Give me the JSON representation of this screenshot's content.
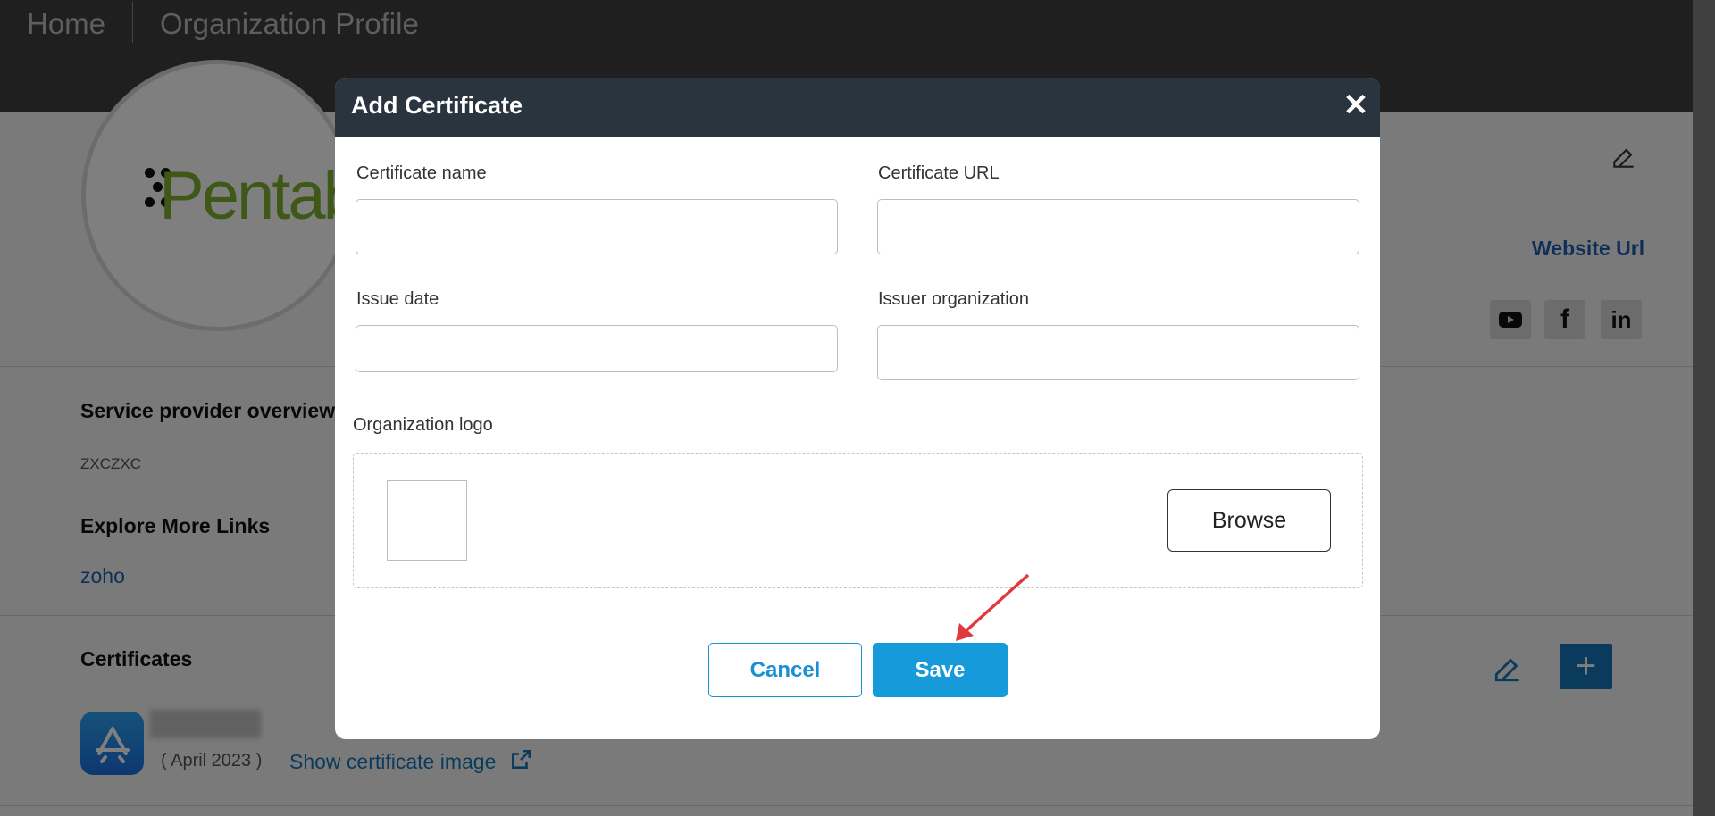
{
  "breadcrumb": {
    "home": "Home",
    "current": "Organization Profile"
  },
  "profile": {
    "logo_text": "Pentab",
    "website_link": "Website Url",
    "social": [
      "youtube-icon",
      "facebook-icon",
      "linkedin-icon"
    ]
  },
  "overview": {
    "title": "Service provider overview",
    "text": "ZXCZXC"
  },
  "links": {
    "title": "Explore More Links",
    "items": [
      "zoho"
    ]
  },
  "certificates": {
    "title": "Certificates",
    "date": "( April 2023 )",
    "show_image": "Show certificate image"
  },
  "modal": {
    "title": "Add Certificate",
    "fields": {
      "name_label": "Certificate name",
      "url_label": "Certificate URL",
      "date_label": "Issue date",
      "issuer_label": "Issuer organization",
      "logo_label": "Organization logo",
      "name_value": "",
      "url_value": "",
      "date_value": "",
      "issuer_value": ""
    },
    "browse_label": "Browse",
    "cancel_label": "Cancel",
    "save_label": "Save"
  },
  "colors": {
    "accent": "#169ad9",
    "header": "#2a343f",
    "link": "#1f5fb0",
    "annotation_arrow": "#e0393e"
  }
}
